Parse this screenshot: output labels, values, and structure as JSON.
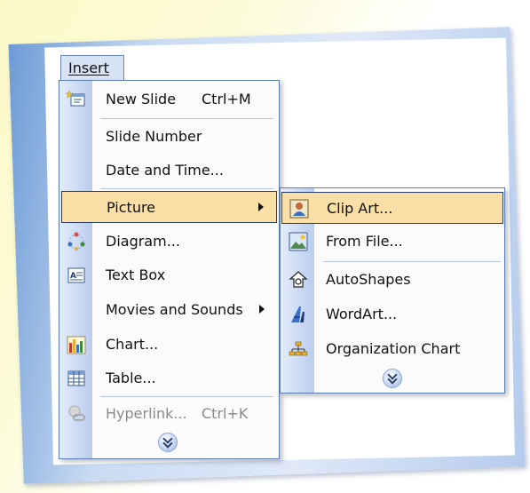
{
  "menubar": {
    "title": "Insert"
  },
  "insert_menu": {
    "items": [
      {
        "label": "New Slide",
        "shortcut": "Ctrl+M",
        "icon": "new-slide-icon"
      },
      {
        "label": "Slide Number",
        "shortcut": "",
        "icon": ""
      },
      {
        "label": "Date and Time...",
        "shortcut": "",
        "icon": ""
      },
      {
        "label": "Picture",
        "shortcut": "",
        "icon": "",
        "has_submenu": true,
        "highlighted": true
      },
      {
        "label": "Diagram...",
        "shortcut": "",
        "icon": "diagram-icon"
      },
      {
        "label": "Text Box",
        "shortcut": "",
        "icon": "text-box-icon"
      },
      {
        "label": "Movies and Sounds",
        "shortcut": "",
        "icon": "",
        "has_submenu": true
      },
      {
        "label": "Chart...",
        "shortcut": "",
        "icon": "chart-icon"
      },
      {
        "label": "Table...",
        "shortcut": "",
        "icon": "table-icon"
      },
      {
        "label": "Hyperlink...",
        "shortcut": "Ctrl+K",
        "icon": "hyperlink-icon",
        "disabled": true
      }
    ],
    "expand_icon": "expand-chevrons-icon"
  },
  "picture_submenu": {
    "items": [
      {
        "label": "Clip Art...",
        "icon": "clip-art-icon",
        "highlighted": true
      },
      {
        "label": "From File...",
        "icon": "from-file-icon"
      },
      {
        "label": "AutoShapes",
        "icon": "autoshapes-icon"
      },
      {
        "label": "WordArt...",
        "icon": "wordart-icon"
      },
      {
        "label": "Organization Chart",
        "icon": "organization-chart-icon"
      }
    ],
    "expand_icon": "expand-chevrons-icon"
  },
  "colors": {
    "highlight": "#fbdfa6",
    "menu_border": "#5d7fb2",
    "gutter": "#b9cdee",
    "frame_blue": "#6d9bd6",
    "background_yellow": "#fbf9c8"
  }
}
